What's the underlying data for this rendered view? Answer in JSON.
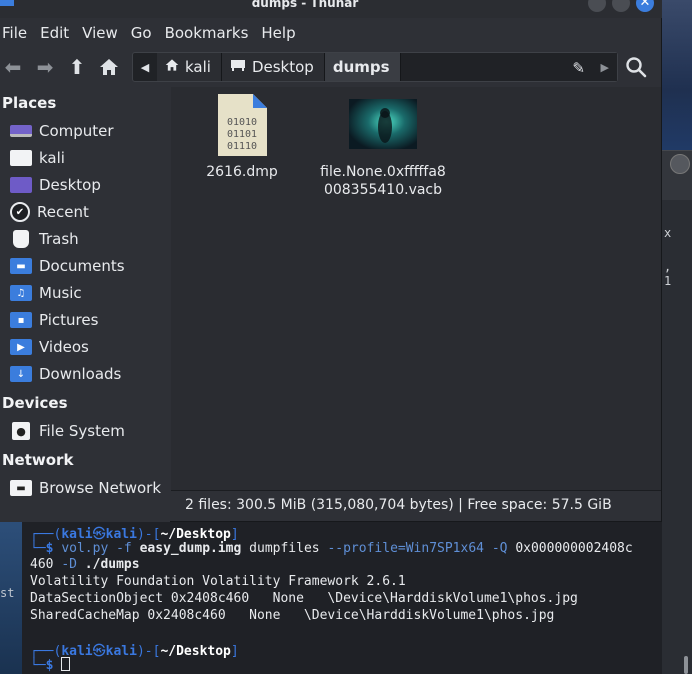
{
  "window": {
    "title": "dumps - Thunar"
  },
  "menu": [
    "File",
    "Edit",
    "View",
    "Go",
    "Bookmarks",
    "Help"
  ],
  "pathbar": {
    "crumbs": [
      {
        "label": "kali",
        "icon": "home-icon"
      },
      {
        "label": "Desktop",
        "icon": "desktop-icon"
      },
      {
        "label": "dumps",
        "icon": ""
      }
    ]
  },
  "sidebar": {
    "places_title": "Places",
    "places": [
      {
        "label": "Computer",
        "icon": "computer-icon"
      },
      {
        "label": "kali",
        "icon": "home-folder-icon"
      },
      {
        "label": "Desktop",
        "icon": "desktop-folder-icon"
      },
      {
        "label": "Recent",
        "icon": "recent-icon"
      },
      {
        "label": "Trash",
        "icon": "trash-icon"
      },
      {
        "label": "Documents",
        "icon": "documents-folder-icon"
      },
      {
        "label": "Music",
        "icon": "music-folder-icon"
      },
      {
        "label": "Pictures",
        "icon": "pictures-folder-icon"
      },
      {
        "label": "Videos",
        "icon": "videos-folder-icon"
      },
      {
        "label": "Downloads",
        "icon": "downloads-folder-icon"
      }
    ],
    "devices_title": "Devices",
    "devices": [
      {
        "label": "File System",
        "icon": "drive-icon"
      }
    ],
    "network_title": "Network",
    "network": [
      {
        "label": "Browse Network",
        "icon": "network-icon"
      }
    ]
  },
  "files": [
    {
      "name": "2616.dmp",
      "icon": "binary-file-icon",
      "binary_rows": [
        "01010",
        "01101",
        "01110"
      ]
    },
    {
      "name_line1": "file.None.0xfffffa8",
      "name_line2": "008355410.vacb",
      "icon": "image-thumbnail-icon"
    }
  ],
  "status": {
    "text": "2 files: 300.5 MiB (315,080,704 bytes) | Free space: 57.5 GiB"
  },
  "background": {
    "right_glyph_1": "x",
    "right_glyph_2": ",",
    "right_glyph_3": "1",
    "left_text": "st"
  },
  "terminal": {
    "user": "kali",
    "at_symbol": "㉿",
    "host": "kali",
    "cwd": "~/Desktop",
    "cmd1_prog": "vol.py",
    "cmd1_opt_f": "-f",
    "cmd1_file": "easy_dump.img",
    "cmd1_plugin": "dumpfiles",
    "cmd1_profile": "--profile=Win7SP1x64",
    "cmd1_q": "-Q",
    "cmd1_addr": "0x000000002408c",
    "cmd1_cont": "460",
    "cmd1_opt_d": "-D",
    "cmd1_dir": "./dumps",
    "out1": "Volatility Foundation Volatility Framework 2.6.1",
    "out2": "DataSectionObject 0x2408c460   None   \\Device\\HarddiskVolume1\\phos.jpg",
    "out3": "SharedCacheMap 0x2408c460   None   \\Device\\HarddiskVolume1\\phos.jpg",
    "prompt_char": "$"
  },
  "colors": {
    "accent": "#3b7ddd",
    "terminal_prompt": "#3a78e0"
  }
}
